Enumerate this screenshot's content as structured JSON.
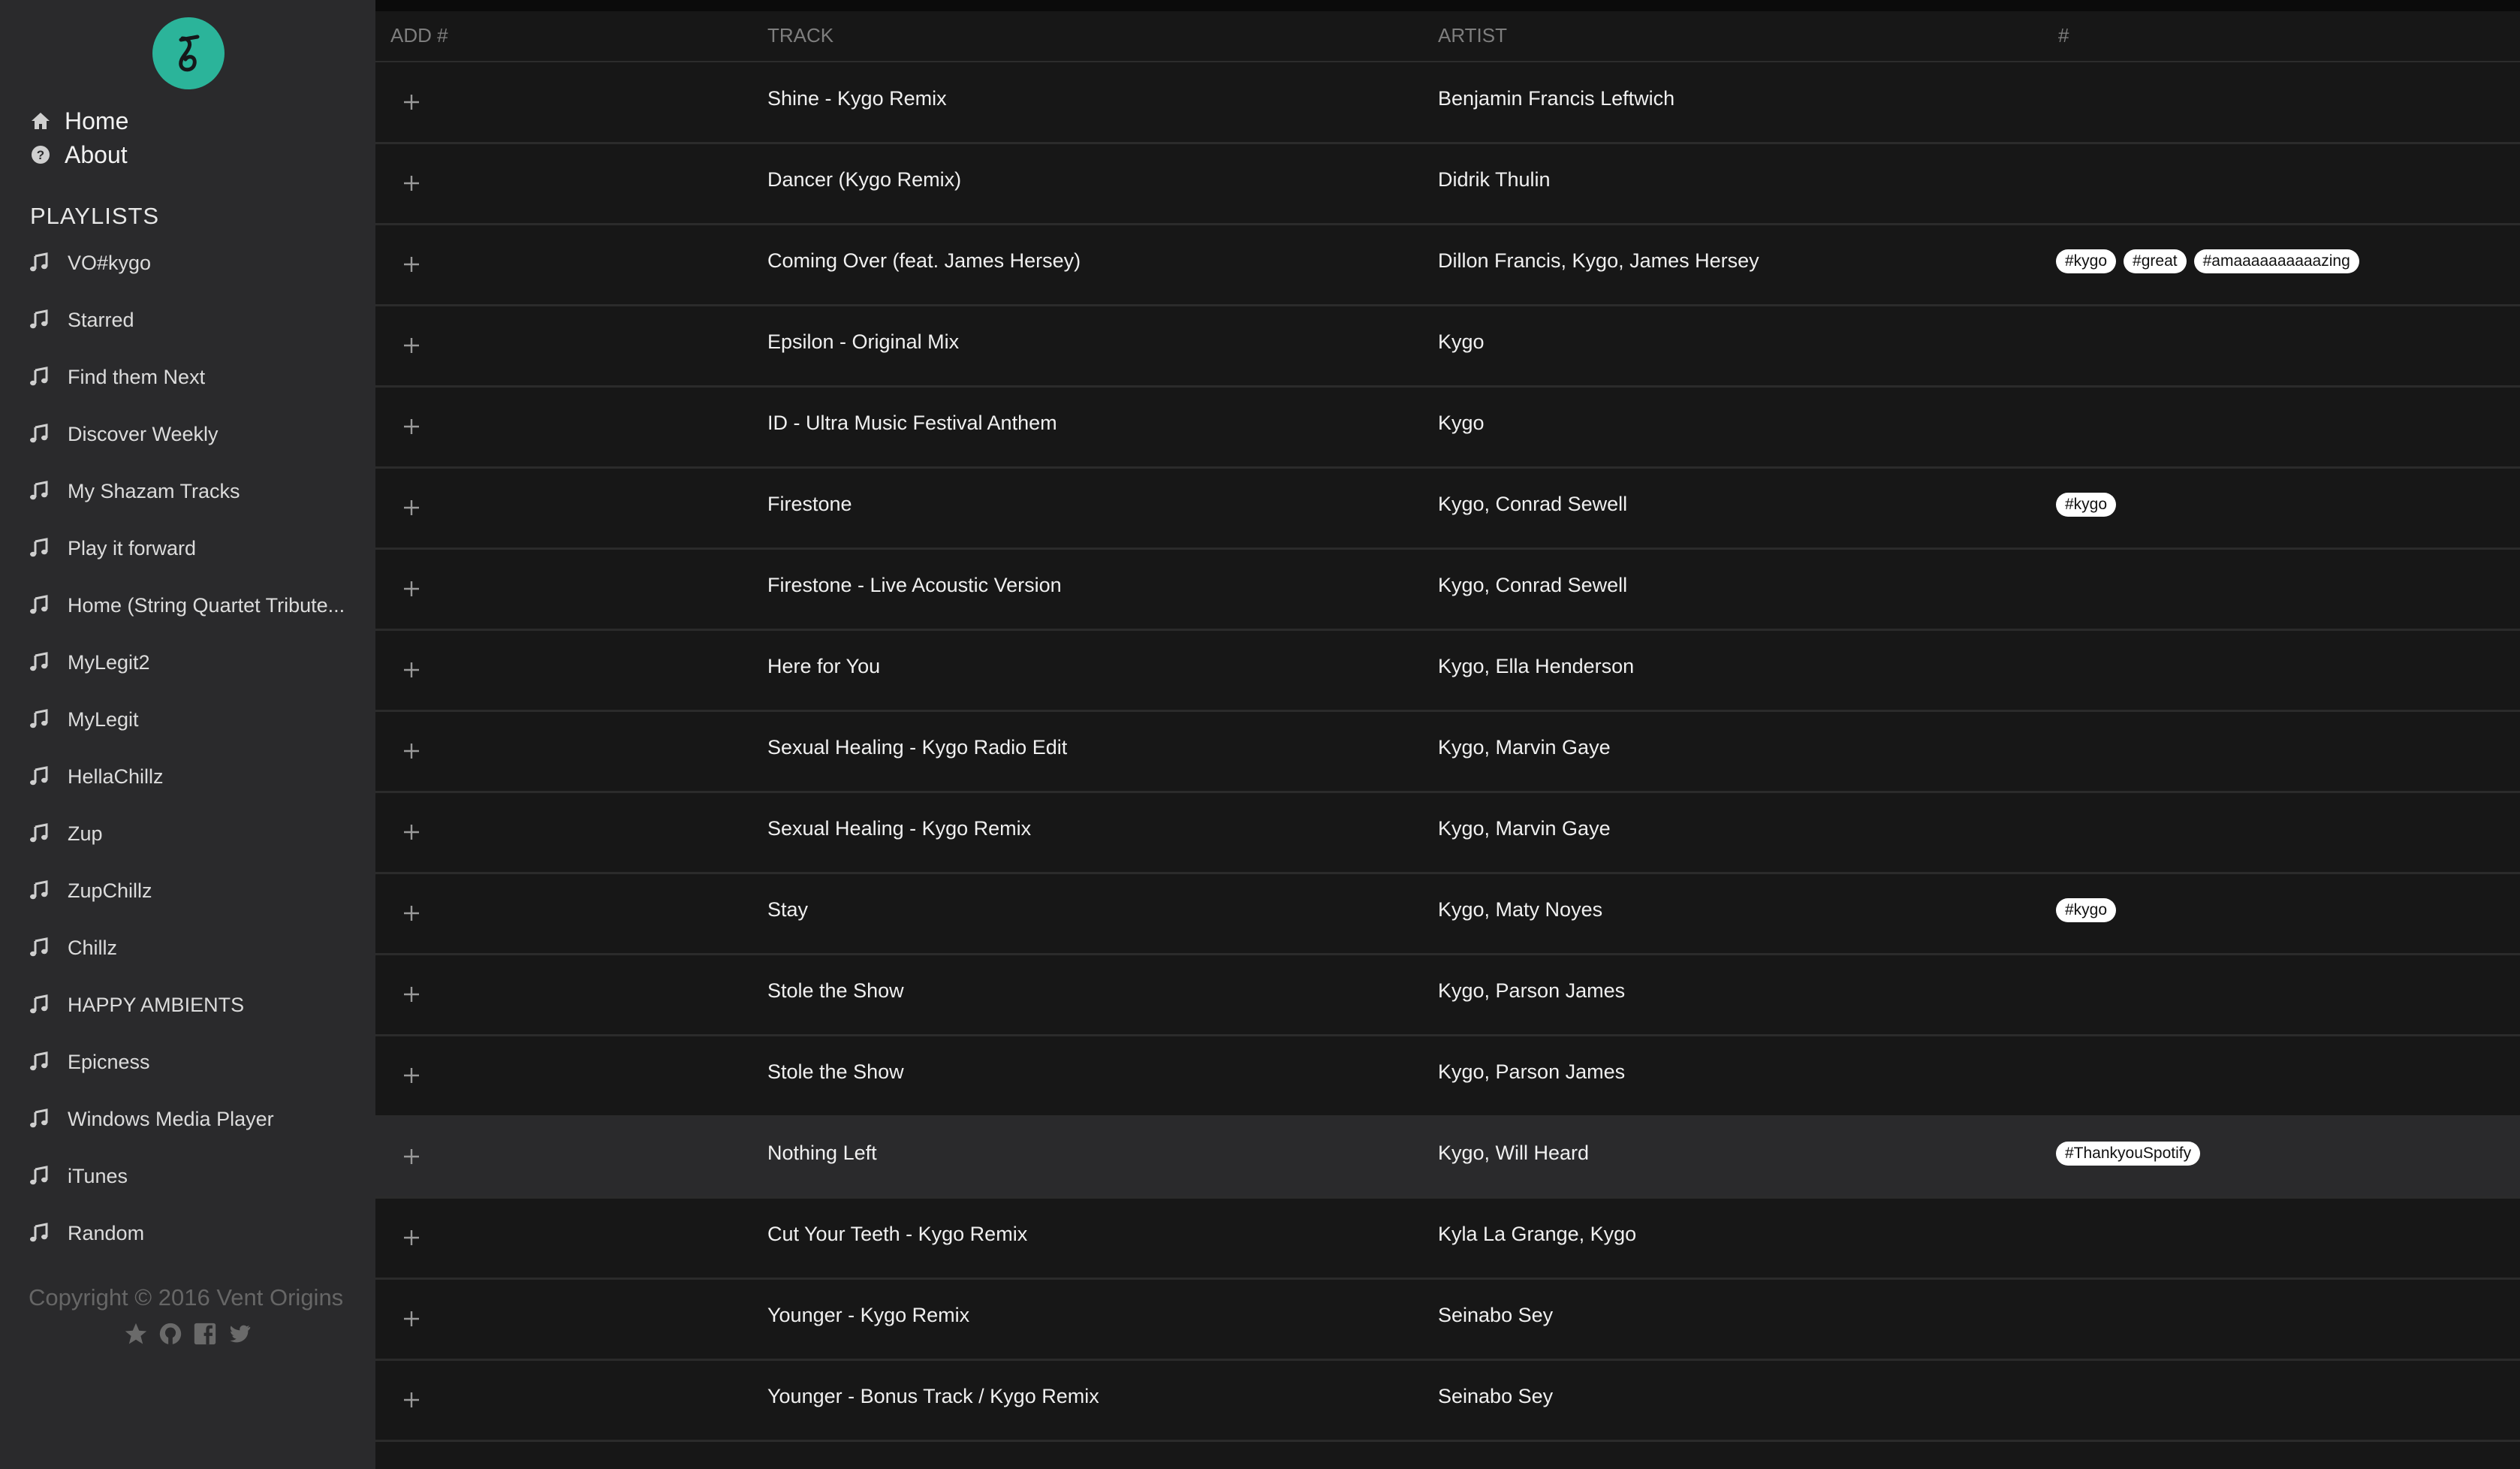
{
  "colors": {
    "accent": "#2bb49a",
    "sidebar_bg": "#2a2a2c",
    "main_bg": "#171717",
    "highlight_row": "#2a2a2c"
  },
  "nav": [
    {
      "label": "Home",
      "icon": "home-icon"
    },
    {
      "label": "About",
      "icon": "question-circle-icon"
    }
  ],
  "sidebar": {
    "playlists_heading": "PLAYLISTS",
    "playlists": [
      "VO#kygo",
      "Starred",
      "Find them Next",
      "Discover Weekly",
      "My Shazam Tracks",
      "Play it forward",
      "Home (String Quartet Tribute...",
      "MyLegit2",
      "MyLegit",
      "HellaChillz",
      "Zup",
      "ZupChillz",
      "Chillz",
      "HAPPY AMBIENTS",
      "Epicness",
      "Windows Media Player",
      "iTunes",
      "Random"
    ],
    "copyright": "Copyright © 2016 Vent Origins",
    "social_icons": [
      "star-icon",
      "github-icon",
      "facebook-icon",
      "twitter-icon"
    ]
  },
  "table": {
    "headers": {
      "add": "ADD #",
      "track": "TRACK",
      "artist": "ARTIST",
      "tags": "#"
    },
    "rows": [
      {
        "track": "Shine - Kygo Remix",
        "artist": "Benjamin Francis Leftwich",
        "tags": []
      },
      {
        "track": "Dancer (Kygo Remix)",
        "artist": "Didrik Thulin",
        "tags": []
      },
      {
        "track": "Coming Over (feat. James Hersey)",
        "artist": "Dillon Francis, Kygo, James Hersey",
        "tags": [
          "#kygo",
          "#great",
          "#amaaaaaaaaaazing"
        ]
      },
      {
        "track": "Epsilon - Original Mix",
        "artist": "Kygo",
        "tags": []
      },
      {
        "track": "ID - Ultra Music Festival Anthem",
        "artist": "Kygo",
        "tags": []
      },
      {
        "track": "Firestone",
        "artist": "Kygo, Conrad Sewell",
        "tags": [
          "#kygo"
        ]
      },
      {
        "track": "Firestone - Live Acoustic Version",
        "artist": "Kygo, Conrad Sewell",
        "tags": []
      },
      {
        "track": "Here for You",
        "artist": "Kygo, Ella Henderson",
        "tags": []
      },
      {
        "track": "Sexual Healing - Kygo Radio Edit",
        "artist": "Kygo, Marvin Gaye",
        "tags": []
      },
      {
        "track": "Sexual Healing - Kygo Remix",
        "artist": "Kygo, Marvin Gaye",
        "tags": []
      },
      {
        "track": "Stay",
        "artist": "Kygo, Maty Noyes",
        "tags": [
          "#kygo"
        ]
      },
      {
        "track": "Stole the Show",
        "artist": "Kygo, Parson James",
        "tags": []
      },
      {
        "track": "Stole the Show",
        "artist": "Kygo, Parson James",
        "tags": []
      },
      {
        "track": "Nothing Left",
        "artist": "Kygo, Will Heard",
        "tags": [
          "#ThankyouSpotify"
        ],
        "highlighted": true
      },
      {
        "track": "Cut Your Teeth - Kygo Remix",
        "artist": "Kyla La Grange, Kygo",
        "tags": []
      },
      {
        "track": "Younger - Kygo Remix",
        "artist": "Seinabo Sey",
        "tags": []
      },
      {
        "track": "Younger - Bonus Track / Kygo Remix",
        "artist": "Seinabo Sey",
        "tags": []
      }
    ]
  }
}
